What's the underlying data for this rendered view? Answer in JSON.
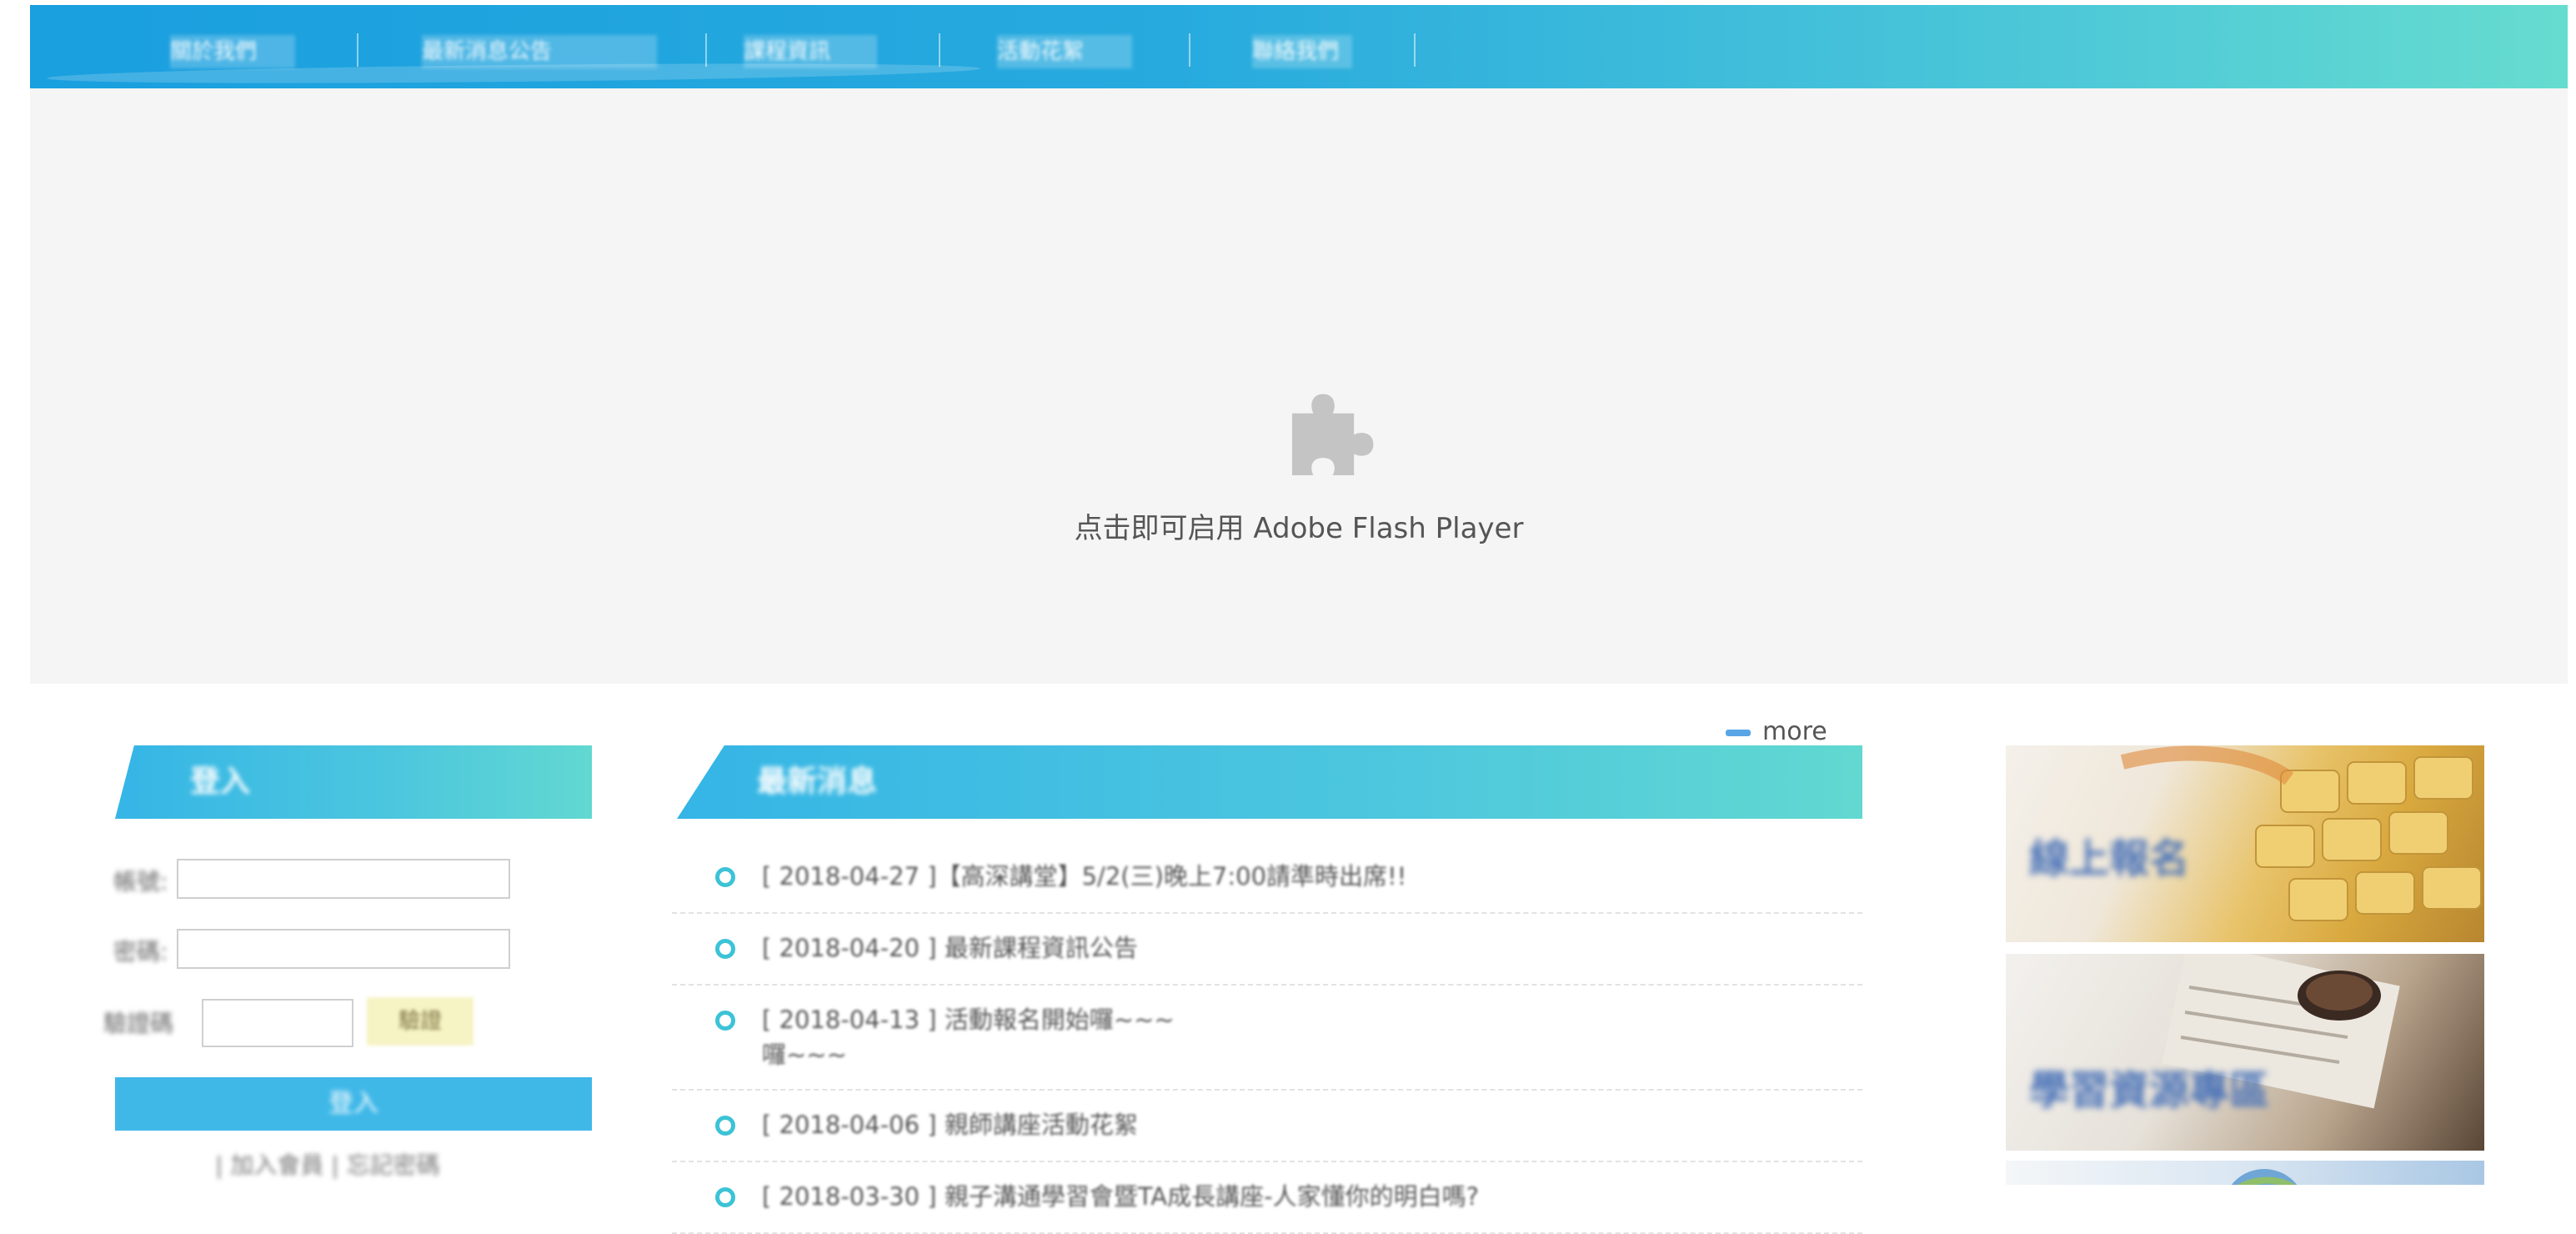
{
  "nav": {
    "items": [
      "關於我們",
      "最新消息公告",
      "課程資訊",
      "活動花絮",
      "聯絡我們"
    ]
  },
  "flash": {
    "message": "点击即可启用 Adobe Flash Player",
    "icon": "puzzle-piece-icon"
  },
  "login": {
    "title": "登入",
    "account_label": "帳號:",
    "account_value": "",
    "password_label": "密碼:",
    "password_value": "",
    "captcha_label": "驗證碼",
    "captcha_value": "",
    "captcha_image_text": "驗證",
    "submit_label": "登入",
    "register_link": "| 加入會員 | 忘記密碼"
  },
  "news": {
    "title": "最新消息",
    "more_label": "more",
    "items": [
      "[ 2018-04-27 ]【高深講堂】5/2(三)晚上7:00請準時出席!!",
      "[ 2018-04-20 ] 最新課程資訊公告",
      "[ 2018-04-13 ] 活動報名開始囉~~~",
      "[ 2018-04-06 ] 親師講座活動花絮",
      "[ 2018-03-30 ] 親子溝通學習會暨TA成長講座-人家懂你的明白嗎?"
    ],
    "overflow_line": "囉~~~"
  },
  "features": [
    {
      "label": "線上報名",
      "image": "keyboard-photo"
    },
    {
      "label": "學習資源專區",
      "image": "coffee-newspaper-photo"
    },
    {
      "label": "",
      "image": "globe-photo"
    }
  ],
  "colors": {
    "nav_start": "#1a9fdf",
    "nav_end": "#66dccf",
    "flash_bg": "#f5f5f5",
    "accent": "#3cc3d6",
    "login_button": "#3fb8e8"
  }
}
